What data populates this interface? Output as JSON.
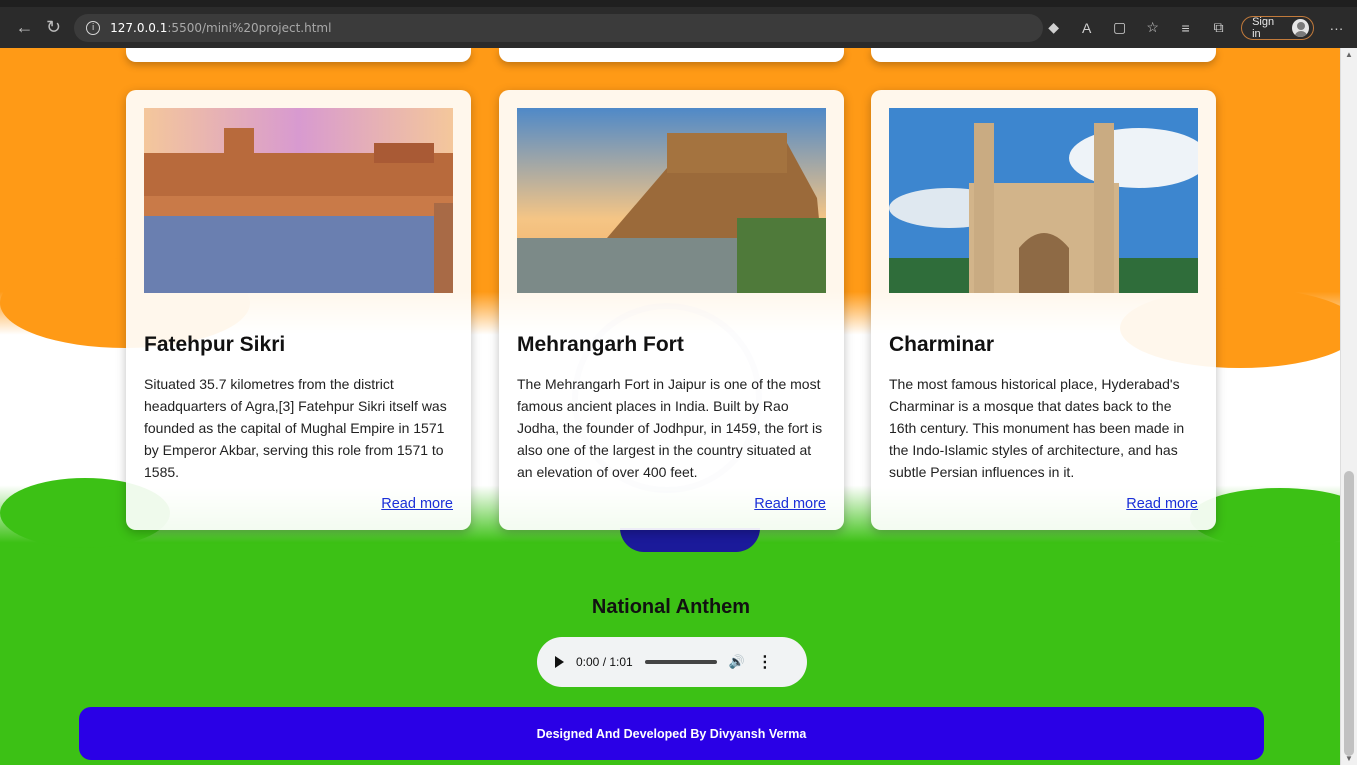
{
  "browser": {
    "url_host": "127.0.0.1",
    "url_path": ":5500/mini%20project.html",
    "sign_in_label": "Sign in",
    "more_label": "···",
    "accent_border": "#c17a3b"
  },
  "cards": [
    {
      "title": "Fatehpur Sikri",
      "description": "Situated 35.7 kilometres from the district headquarters of Agra,[3] Fatehpur Sikri itself was founded as the capital of Mughal Empire in 1571 by Emperor Akbar, serving this role from 1571 to 1585.",
      "link": "Read more"
    },
    {
      "title": "Mehrangarh Fort",
      "description": "The Mehrangarh Fort in Jaipur is one of the most famous ancient places in India. Built by Rao Jodha, the founder of Jodhpur, in 1459, the fort is also one of the largest in the country situated at an elevation of over 400 feet.",
      "link": "Read more"
    },
    {
      "title": "Charminar",
      "description": "The most famous historical place, Hyderabad's Charminar is a mosque that dates back to the 16th century. This monument has been made in the Indo-Islamic styles of architecture, and has subtle Persian influences in it.",
      "link": "Read more"
    }
  ],
  "anthem": {
    "title": "National Anthem",
    "time": "0:00 / 1:01"
  },
  "footer": {
    "text": "Designed And Developed By Divyansh Verma",
    "color": "#2a00e6"
  },
  "colors": {
    "saffron": "#ff9a16",
    "green": "#3cc115",
    "link": "#1a2fd8"
  }
}
